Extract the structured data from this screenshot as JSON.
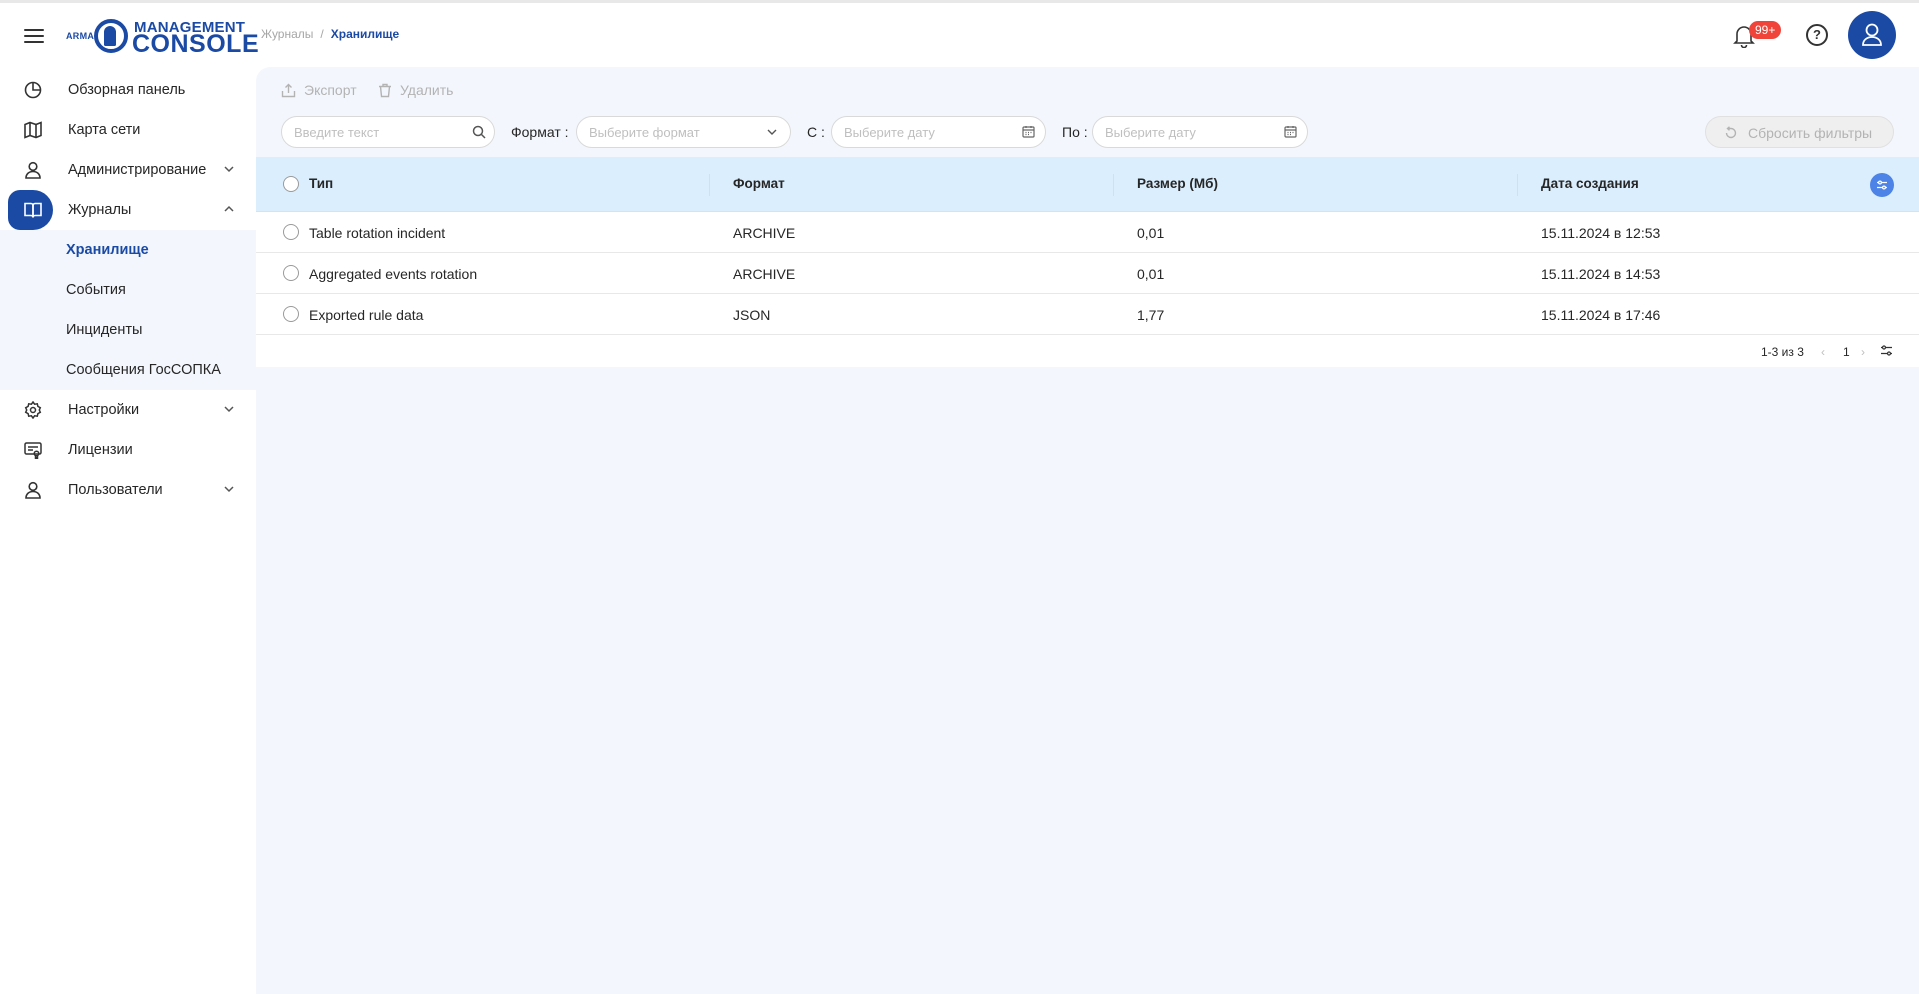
{
  "app": {
    "logo_arma": "ARMA",
    "logo_line1": "MANAGEMENT",
    "logo_line2": "CONSOLE"
  },
  "sidebar": {
    "items": [
      {
        "label": "Обзорная панель",
        "icon": "dashboard-icon"
      },
      {
        "label": "Карта сети",
        "icon": "map-icon"
      },
      {
        "label": "Администрирование",
        "icon": "user-icon",
        "expandable": true
      },
      {
        "label": "Журналы",
        "icon": "book-icon",
        "expandable": true,
        "active": true
      },
      {
        "label": "Настройки",
        "icon": "gear-icon",
        "expandable": true
      },
      {
        "label": "Лицензии",
        "icon": "license-icon"
      },
      {
        "label": "Пользователи",
        "icon": "user-icon",
        "expandable": true
      }
    ],
    "sub_items": [
      {
        "label": "Хранилище",
        "current": true
      },
      {
        "label": "События"
      },
      {
        "label": "Инциденты"
      },
      {
        "label": "Сообщения ГосСОПКА"
      }
    ]
  },
  "header": {
    "breadcrumb": [
      "Журналы",
      "Хранилище"
    ],
    "breadcrumb_sep": "/",
    "notifications_badge": "99+"
  },
  "toolbar": {
    "export_label": "Экспорт",
    "delete_label": "Удалить"
  },
  "filters": {
    "search_placeholder": "Введите текст",
    "format_label": "Формат :",
    "format_placeholder": "Выберите формат",
    "from_label": "С :",
    "from_placeholder": "Выберите дату",
    "to_label": "По :",
    "to_placeholder": "Выберите дату",
    "reset_label": "Сбросить фильтры"
  },
  "table": {
    "columns": [
      "Тип",
      "Формат",
      "Размер (Мб)",
      "Дата создания"
    ],
    "rows": [
      [
        "Table rotation incident",
        "ARCHIVE",
        "0,01",
        "15.11.2024 в 12:53"
      ],
      [
        "Aggregated events rotation",
        "ARCHIVE",
        "0,01",
        "15.11.2024 в 14:53"
      ],
      [
        "Exported rule data",
        "JSON",
        "1,77",
        "15.11.2024 в 17:46"
      ]
    ]
  },
  "pagination": {
    "info": "1-3 из 3",
    "page": "1",
    "prev": "‹",
    "next": "›"
  },
  "colors": {
    "brand": "#1b4aa5",
    "main_bg": "#f3f7fd",
    "table_head_bg": "#dbeefe",
    "badge": "#f0443a"
  }
}
